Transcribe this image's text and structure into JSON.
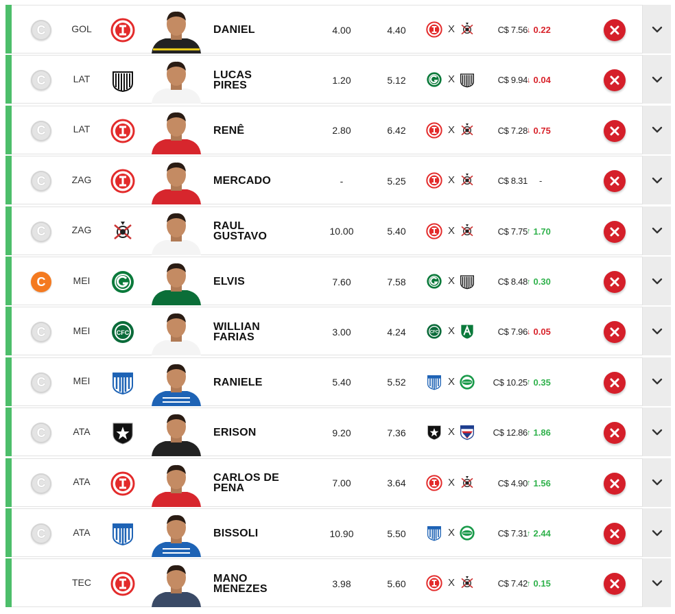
{
  "colors": {
    "accent_bar": "#4dbe6a",
    "remove_button": "#d51f2a",
    "captain_active": "#f47a20",
    "captain_inactive": "#e4e4e4",
    "price_up": "#2fb14b",
    "price_down": "#d8222a"
  },
  "icons": {
    "captain": "C",
    "remove": "close-icon",
    "expand": "chevron-down-icon",
    "var_up": "↑",
    "var_down": "↓"
  },
  "players": [
    {
      "captain_state": "inactive",
      "position": "GOL",
      "club": "internacional",
      "name": "DANIEL",
      "last": "4.00",
      "avg": "4.40",
      "home": "internacional",
      "vs": "X",
      "away": "corinthians",
      "price": "C$ 7.56",
      "variation": "0.22",
      "trend": "down"
    },
    {
      "captain_state": "inactive",
      "position": "LAT",
      "club": "santos",
      "name": "LUCAS PIRES",
      "last": "1.20",
      "avg": "5.12",
      "home": "goias",
      "vs": "X",
      "away": "santos",
      "price": "C$ 9.94",
      "variation": "0.04",
      "trend": "down"
    },
    {
      "captain_state": "inactive",
      "position": "LAT",
      "club": "internacional",
      "name": "RENÊ",
      "last": "2.80",
      "avg": "6.42",
      "home": "internacional",
      "vs": "X",
      "away": "corinthians",
      "price": "C$ 7.28",
      "variation": "0.75",
      "trend": "down"
    },
    {
      "captain_state": "inactive",
      "position": "ZAG",
      "club": "internacional",
      "name": "MERCADO",
      "last": "-",
      "avg": "5.25",
      "home": "internacional",
      "vs": "X",
      "away": "corinthians",
      "price": "C$ 8.31",
      "variation": "-",
      "trend": "none"
    },
    {
      "captain_state": "inactive",
      "position": "ZAG",
      "club": "corinthians",
      "name": "RAUL GUSTAVO",
      "last": "10.00",
      "avg": "5.40",
      "home": "internacional",
      "vs": "X",
      "away": "corinthians",
      "price": "C$ 7.75",
      "variation": "1.70",
      "trend": "up"
    },
    {
      "captain_state": "active",
      "position": "MEI",
      "club": "goias",
      "name": "ELVIS",
      "last": "7.60",
      "avg": "7.58",
      "home": "goias",
      "vs": "X",
      "away": "santos",
      "price": "C$ 8.48",
      "variation": "0.30",
      "trend": "up"
    },
    {
      "captain_state": "inactive",
      "position": "MEI",
      "club": "coritiba",
      "name": "WILLIAN FARIAS",
      "last": "3.00",
      "avg": "4.24",
      "home": "coritiba",
      "vs": "X",
      "away": "america-mg",
      "price": "C$ 7.96",
      "variation": "0.05",
      "trend": "down"
    },
    {
      "captain_state": "inactive",
      "position": "MEI",
      "club": "avai",
      "name": "RANIELE",
      "last": "5.40",
      "avg": "5.52",
      "home": "avai",
      "vs": "X",
      "away": "juventude",
      "price": "C$ 10.25",
      "variation": "0.35",
      "trend": "up"
    },
    {
      "captain_state": "inactive",
      "position": "ATA",
      "club": "botafogo",
      "name": "ERISON",
      "last": "9.20",
      "avg": "7.36",
      "home": "botafogo",
      "vs": "X",
      "away": "fortaleza",
      "price": "C$ 12.86",
      "variation": "1.86",
      "trend": "up"
    },
    {
      "captain_state": "inactive",
      "position": "ATA",
      "club": "internacional",
      "name": "CARLOS DE PENA",
      "last": "7.00",
      "avg": "3.64",
      "home": "internacional",
      "vs": "X",
      "away": "corinthians",
      "price": "C$ 4.90",
      "variation": "1.56",
      "trend": "up"
    },
    {
      "captain_state": "inactive",
      "position": "ATA",
      "club": "avai",
      "name": "BISSOLI",
      "last": "10.90",
      "avg": "5.50",
      "home": "avai",
      "vs": "X",
      "away": "juventude",
      "price": "C$ 7.31",
      "variation": "2.44",
      "trend": "up"
    },
    {
      "captain_state": "hidden",
      "position": "TEC",
      "club": "internacional",
      "name": "MANO MENEZES",
      "last": "3.98",
      "avg": "5.60",
      "home": "internacional",
      "vs": "X",
      "away": "corinthians",
      "price": "C$ 7.42",
      "variation": "0.15",
      "trend": "up"
    }
  ]
}
